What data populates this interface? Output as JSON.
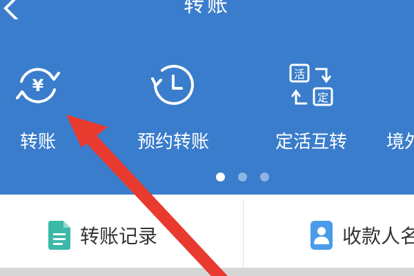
{
  "header": {
    "title": "转账",
    "back_icon": "back-chevron-icon",
    "background_color": "#3a7dcc"
  },
  "functions": [
    {
      "label": "转账",
      "icon": "yen-circular-arrows-icon"
    },
    {
      "label": "预约转账",
      "icon": "clock-icon"
    },
    {
      "label": "定活互转",
      "icon": "fixed-current-exchange-icon"
    },
    {
      "label": "境外",
      "icon": ""
    }
  ],
  "fixed_exchange_icon_text": {
    "top": "活",
    "bottom": "定"
  },
  "pager": {
    "total": 3,
    "active": 1
  },
  "quick_links": [
    {
      "label": "转账记录",
      "icon": "document-icon",
      "color": "#3cb8a8"
    },
    {
      "label": "收款人名",
      "icon": "contacts-icon",
      "color": "#4a9be8"
    }
  ],
  "annotation": {
    "color": "#e83a2e"
  }
}
